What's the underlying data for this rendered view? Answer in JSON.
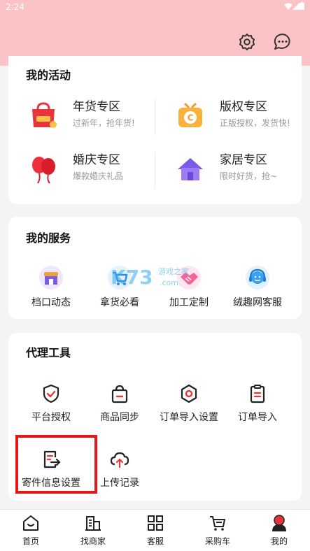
{
  "status_bar": {
    "time": "2:24",
    "system_icons": [
      "wifi-icon",
      "signal-icon",
      "battery-icon"
    ]
  },
  "header": {
    "icons": [
      "settings-icon",
      "message-icon"
    ],
    "background": "#fbc3c6"
  },
  "my_activities": {
    "title": "我的活动",
    "items": [
      {
        "title": "年货专区",
        "subtitle": "过新年，抢年货!",
        "icon": "shopping-bag-icon"
      },
      {
        "title": "版权专区",
        "subtitle": "正版授权，发货快!",
        "icon": "tv-icon"
      },
      {
        "title": "婚庆专区",
        "subtitle": "爆款婚庆礼品",
        "icon": "balloon-icon"
      },
      {
        "title": "家居专区",
        "subtitle": "限时好货，抢~",
        "icon": "house-icon"
      }
    ]
  },
  "my_services": {
    "title": "我的服务",
    "items": [
      {
        "label": "档口动态",
        "icon": "store-icon"
      },
      {
        "label": "拿货必看",
        "icon": "cart-icon"
      },
      {
        "label": "加工定制",
        "icon": "handshake-icon"
      },
      {
        "label": "绒趣网客服",
        "icon": "customer-service-icon"
      }
    ]
  },
  "watermark": {
    "text": "K73",
    "subtext": "游戏之家",
    "domain": ".com"
  },
  "agent_tools": {
    "title": "代理工具",
    "items": [
      {
        "label": "平台授权",
        "icon": "shield-check-icon"
      },
      {
        "label": "商品同步",
        "icon": "bag-icon"
      },
      {
        "label": "订单导入设置",
        "icon": "order-settings-icon"
      },
      {
        "label": "订单导入",
        "icon": "clipboard-icon"
      },
      {
        "label": "寄件信息设置",
        "icon": "document-export-icon"
      },
      {
        "label": "上传记录",
        "icon": "cloud-upload-icon"
      }
    ]
  },
  "tabbar": {
    "items": [
      {
        "label": "首页",
        "icon": "home-icon"
      },
      {
        "label": "找商家",
        "icon": "building-icon"
      },
      {
        "label": "客服",
        "icon": "grid-icon"
      },
      {
        "label": "采购车",
        "icon": "shopping-cart-icon"
      },
      {
        "label": "我的",
        "icon": "profile-icon",
        "active": true
      }
    ]
  },
  "colors": {
    "accent": "#e81717",
    "highlight": "#e81717"
  }
}
